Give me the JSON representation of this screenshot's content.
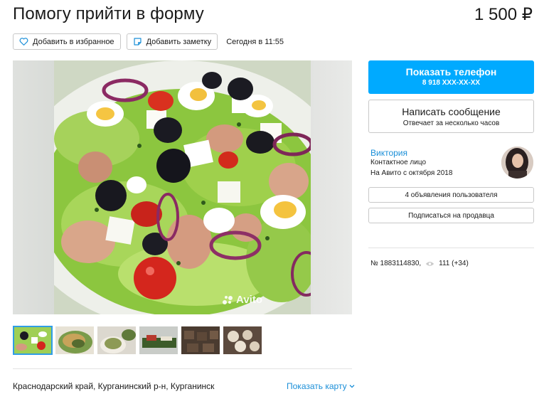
{
  "listing": {
    "title": "Помогу прийти в форму",
    "price": "1 500 ₽",
    "date": "Сегодня в 11:55"
  },
  "actions": {
    "favorite": {
      "label": "Добавить в избранное",
      "icon": "heart-icon"
    },
    "note": {
      "label": "Добавить заметку",
      "icon": "note-icon"
    }
  },
  "gallery": {
    "watermark": "Avito",
    "thumbnail_count": 6,
    "active_thumbnail": 1
  },
  "location": {
    "address": "Краснодарский край, Курганинский р-н, Курганинск",
    "show_map": "Показать карту"
  },
  "contact": {
    "phone_button": "Показать телефон",
    "phone_masked": "8 918 XXX-XX-XX",
    "message_button": "Написать сообщение",
    "message_sub": "Отвечает за несколько часов"
  },
  "seller": {
    "name": "Виктория",
    "role": "Контактное лицо",
    "since": "На Авито с октября 2018",
    "ads_button": "4 объявления пользователя",
    "subscribe_button": "Подписаться на продавца"
  },
  "meta": {
    "item_number": "№ 1883114830,",
    "views": "111 (+34)",
    "views_icon": "eye-icon"
  },
  "colors": {
    "accent": "#00aaff",
    "link": "#1b8fd8",
    "border": "#c8c8c8"
  }
}
